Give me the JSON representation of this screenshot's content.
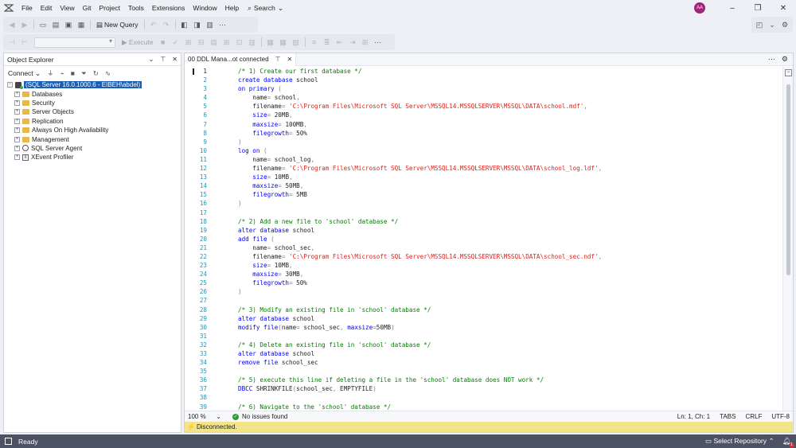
{
  "menu": [
    "File",
    "Edit",
    "View",
    "Git",
    "Project",
    "Tools",
    "Extensions",
    "Window",
    "Help"
  ],
  "search_label": "Search",
  "user_initials": "AA",
  "toolbar": {
    "new_query": "New Query",
    "execute": "Execute"
  },
  "object_explorer": {
    "title": "Object Explorer",
    "connect_label": "Connect",
    "server": "(SQL Server 16.0.1000.6 - EIBEH\\abdel)",
    "nodes": [
      "Databases",
      "Security",
      "Server Objects",
      "Replication",
      "Always On High Availability",
      "Management",
      "SQL Server Agent",
      "XEvent Profiler"
    ]
  },
  "editor": {
    "tab_title": "00 DDL Mana...ot connected",
    "zoom": "100 %",
    "issues": "No issues found",
    "position": "Ln: 1, Ch: 1",
    "indent": "TABS",
    "line_ending": "CRLF",
    "encoding": "UTF-8",
    "connection_status": "Disconnected.",
    "lines": [
      [
        [
          "c",
          "/* 1) Create our first database */"
        ]
      ],
      [
        [
          "k",
          "create database"
        ],
        [
          "",
          " school"
        ]
      ],
      [
        [
          "k",
          "on primary"
        ],
        [
          "g",
          " ("
        ]
      ],
      [
        [
          "",
          "    name"
        ],
        [
          "g",
          "="
        ],
        [
          "",
          " school"
        ],
        [
          "g",
          ","
        ]
      ],
      [
        [
          "",
          "    filename"
        ],
        [
          "g",
          "="
        ],
        [
          "",
          " "
        ],
        [
          "s",
          "'C:\\Program Files\\Microsoft SQL Server\\MSSQL14.MSSQLSERVER\\MSSQL\\DATA\\school.mdf'"
        ],
        [
          "g",
          ","
        ]
      ],
      [
        [
          "k",
          "    size"
        ],
        [
          "g",
          "="
        ],
        [
          "",
          " 20MB"
        ],
        [
          "g",
          ","
        ]
      ],
      [
        [
          "k",
          "    maxsize"
        ],
        [
          "g",
          "="
        ],
        [
          "",
          " 100MB"
        ],
        [
          "g",
          ","
        ]
      ],
      [
        [
          "k",
          "    filegrowth"
        ],
        [
          "g",
          "="
        ],
        [
          "",
          " 50%"
        ]
      ],
      [
        [
          "g",
          ")"
        ]
      ],
      [
        [
          "k",
          "log on"
        ],
        [
          "g",
          " ("
        ]
      ],
      [
        [
          "",
          "    name"
        ],
        [
          "g",
          "="
        ],
        [
          "",
          " school_log"
        ],
        [
          "g",
          ","
        ]
      ],
      [
        [
          "",
          "    filename"
        ],
        [
          "g",
          "="
        ],
        [
          "",
          " "
        ],
        [
          "s",
          "'C:\\Program Files\\Microsoft SQL Server\\MSSQL14.MSSQLSERVER\\MSSQL\\DATA\\school_log.ldf'"
        ],
        [
          "g",
          ","
        ]
      ],
      [
        [
          "k",
          "    size"
        ],
        [
          "g",
          "="
        ],
        [
          "",
          " 10MB"
        ],
        [
          "g",
          ","
        ]
      ],
      [
        [
          "k",
          "    maxsize"
        ],
        [
          "g",
          "="
        ],
        [
          "",
          " 50MB"
        ],
        [
          "g",
          ","
        ]
      ],
      [
        [
          "k",
          "    filegrowth"
        ],
        [
          "g",
          "="
        ],
        [
          "",
          " 5MB"
        ]
      ],
      [
        [
          "g",
          ")"
        ]
      ],
      [
        [
          "",
          ""
        ]
      ],
      [
        [
          "c",
          "/* 2) Add a new file to 'school' database */"
        ]
      ],
      [
        [
          "k",
          "alter database"
        ],
        [
          "",
          " school"
        ]
      ],
      [
        [
          "k",
          "add file"
        ],
        [
          "g",
          " ("
        ]
      ],
      [
        [
          "",
          "    name"
        ],
        [
          "g",
          "="
        ],
        [
          "",
          " school_sec"
        ],
        [
          "g",
          ","
        ]
      ],
      [
        [
          "",
          "    filename"
        ],
        [
          "g",
          "="
        ],
        [
          "",
          " "
        ],
        [
          "s",
          "'C:\\Program Files\\Microsoft SQL Server\\MSSQL14.MSSQLSERVER\\MSSQL\\DATA\\school_sec.ndf'"
        ],
        [
          "g",
          ","
        ]
      ],
      [
        [
          "k",
          "    size"
        ],
        [
          "g",
          "="
        ],
        [
          "",
          " 10MB"
        ],
        [
          "g",
          ","
        ]
      ],
      [
        [
          "k",
          "    maxsize"
        ],
        [
          "g",
          "="
        ],
        [
          "",
          " 30MB"
        ],
        [
          "g",
          ","
        ]
      ],
      [
        [
          "k",
          "    filegrowth"
        ],
        [
          "g",
          "="
        ],
        [
          "",
          " 50%"
        ]
      ],
      [
        [
          "g",
          ")"
        ]
      ],
      [
        [
          "",
          ""
        ]
      ],
      [
        [
          "c",
          "/* 3) Modify an existing file in 'school' database */"
        ]
      ],
      [
        [
          "k",
          "alter database"
        ],
        [
          "",
          " school"
        ]
      ],
      [
        [
          "k",
          "modify file"
        ],
        [
          "g",
          "("
        ],
        [
          "",
          "name"
        ],
        [
          "g",
          "="
        ],
        [
          "",
          " school_sec"
        ],
        [
          "g",
          ","
        ],
        [
          "",
          " "
        ],
        [
          "k",
          "maxsize"
        ],
        [
          "g",
          "="
        ],
        [
          "",
          "50MB"
        ],
        [
          "g",
          ")"
        ]
      ],
      [
        [
          "",
          ""
        ]
      ],
      [
        [
          "c",
          "/* 4) Delete an existing file in 'school' database */"
        ]
      ],
      [
        [
          "k",
          "alter database"
        ],
        [
          "",
          " school"
        ]
      ],
      [
        [
          "k",
          "remove file"
        ],
        [
          "",
          " school_sec"
        ]
      ],
      [
        [
          "",
          ""
        ]
      ],
      [
        [
          "c",
          "/* 5) execute this line if deleting a file in the 'school' database does NOT work */"
        ]
      ],
      [
        [
          "k",
          "DBCC"
        ],
        [
          "",
          " SHRINKFILE"
        ],
        [
          "g",
          "("
        ],
        [
          "",
          "school_sec"
        ],
        [
          "g",
          ","
        ],
        [
          "",
          " EMPTYFILE"
        ],
        [
          "g",
          ")"
        ]
      ],
      [
        [
          "",
          ""
        ]
      ],
      [
        [
          "c",
          "/* 6) Navigate to the 'school' database */"
        ]
      ]
    ]
  },
  "statusbar": {
    "ready": "Ready",
    "repo": "Select Repository",
    "notifications": "1"
  },
  "colors": {
    "keyword": "#0000ff",
    "comment": "#008000",
    "string": "#e0201b",
    "line_number": "#2b91af",
    "selection": "#1a5fb4",
    "connection_bar": "#f3e487",
    "status_bar": "#4a5263"
  }
}
